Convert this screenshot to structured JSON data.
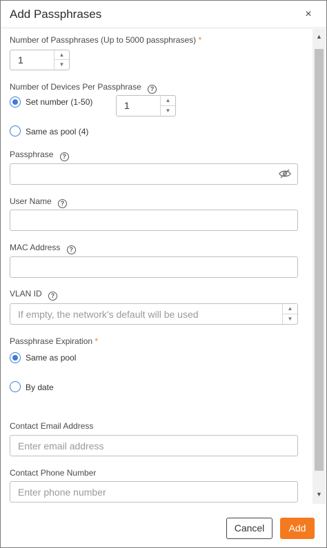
{
  "dialog": {
    "title": "Add Passphrases",
    "close_symbol": "×"
  },
  "form": {
    "num_passphrases": {
      "label": "Number of Passphrases (Up to 5000 passphrases)",
      "required_mark": "*",
      "value": "1"
    },
    "devices_per_passphrase": {
      "label": "Number of Devices Per Passphrase",
      "help_glyph": "?",
      "options": [
        {
          "label": "Set number (1-50)",
          "checked": true
        },
        {
          "label": "Same as pool (4)",
          "checked": false
        }
      ],
      "set_number_value": "1"
    },
    "passphrase": {
      "label": "Passphrase",
      "help_glyph": "?",
      "value": ""
    },
    "user_name": {
      "label": "User Name",
      "help_glyph": "?",
      "value": ""
    },
    "mac_address": {
      "label": "MAC Address",
      "help_glyph": "?",
      "value": ""
    },
    "vlan_id": {
      "label": "VLAN ID",
      "help_glyph": "?",
      "placeholder": "If empty, the network's default will be used"
    },
    "expiration": {
      "label": "Passphrase Expiration",
      "required_mark": "*",
      "options": [
        {
          "label": "Same as pool",
          "checked": true
        },
        {
          "label": "By date",
          "checked": false
        }
      ]
    },
    "contact_email": {
      "label": "Contact Email Address",
      "placeholder": "Enter email address"
    },
    "contact_phone": {
      "label": "Contact Phone Number",
      "placeholder": "Enter phone number"
    }
  },
  "footer": {
    "cancel_label": "Cancel",
    "add_label": "Add"
  },
  "colors": {
    "accent": "#3b7dd8",
    "primary_button": "#f47a1f",
    "required": "#f47a1f"
  }
}
